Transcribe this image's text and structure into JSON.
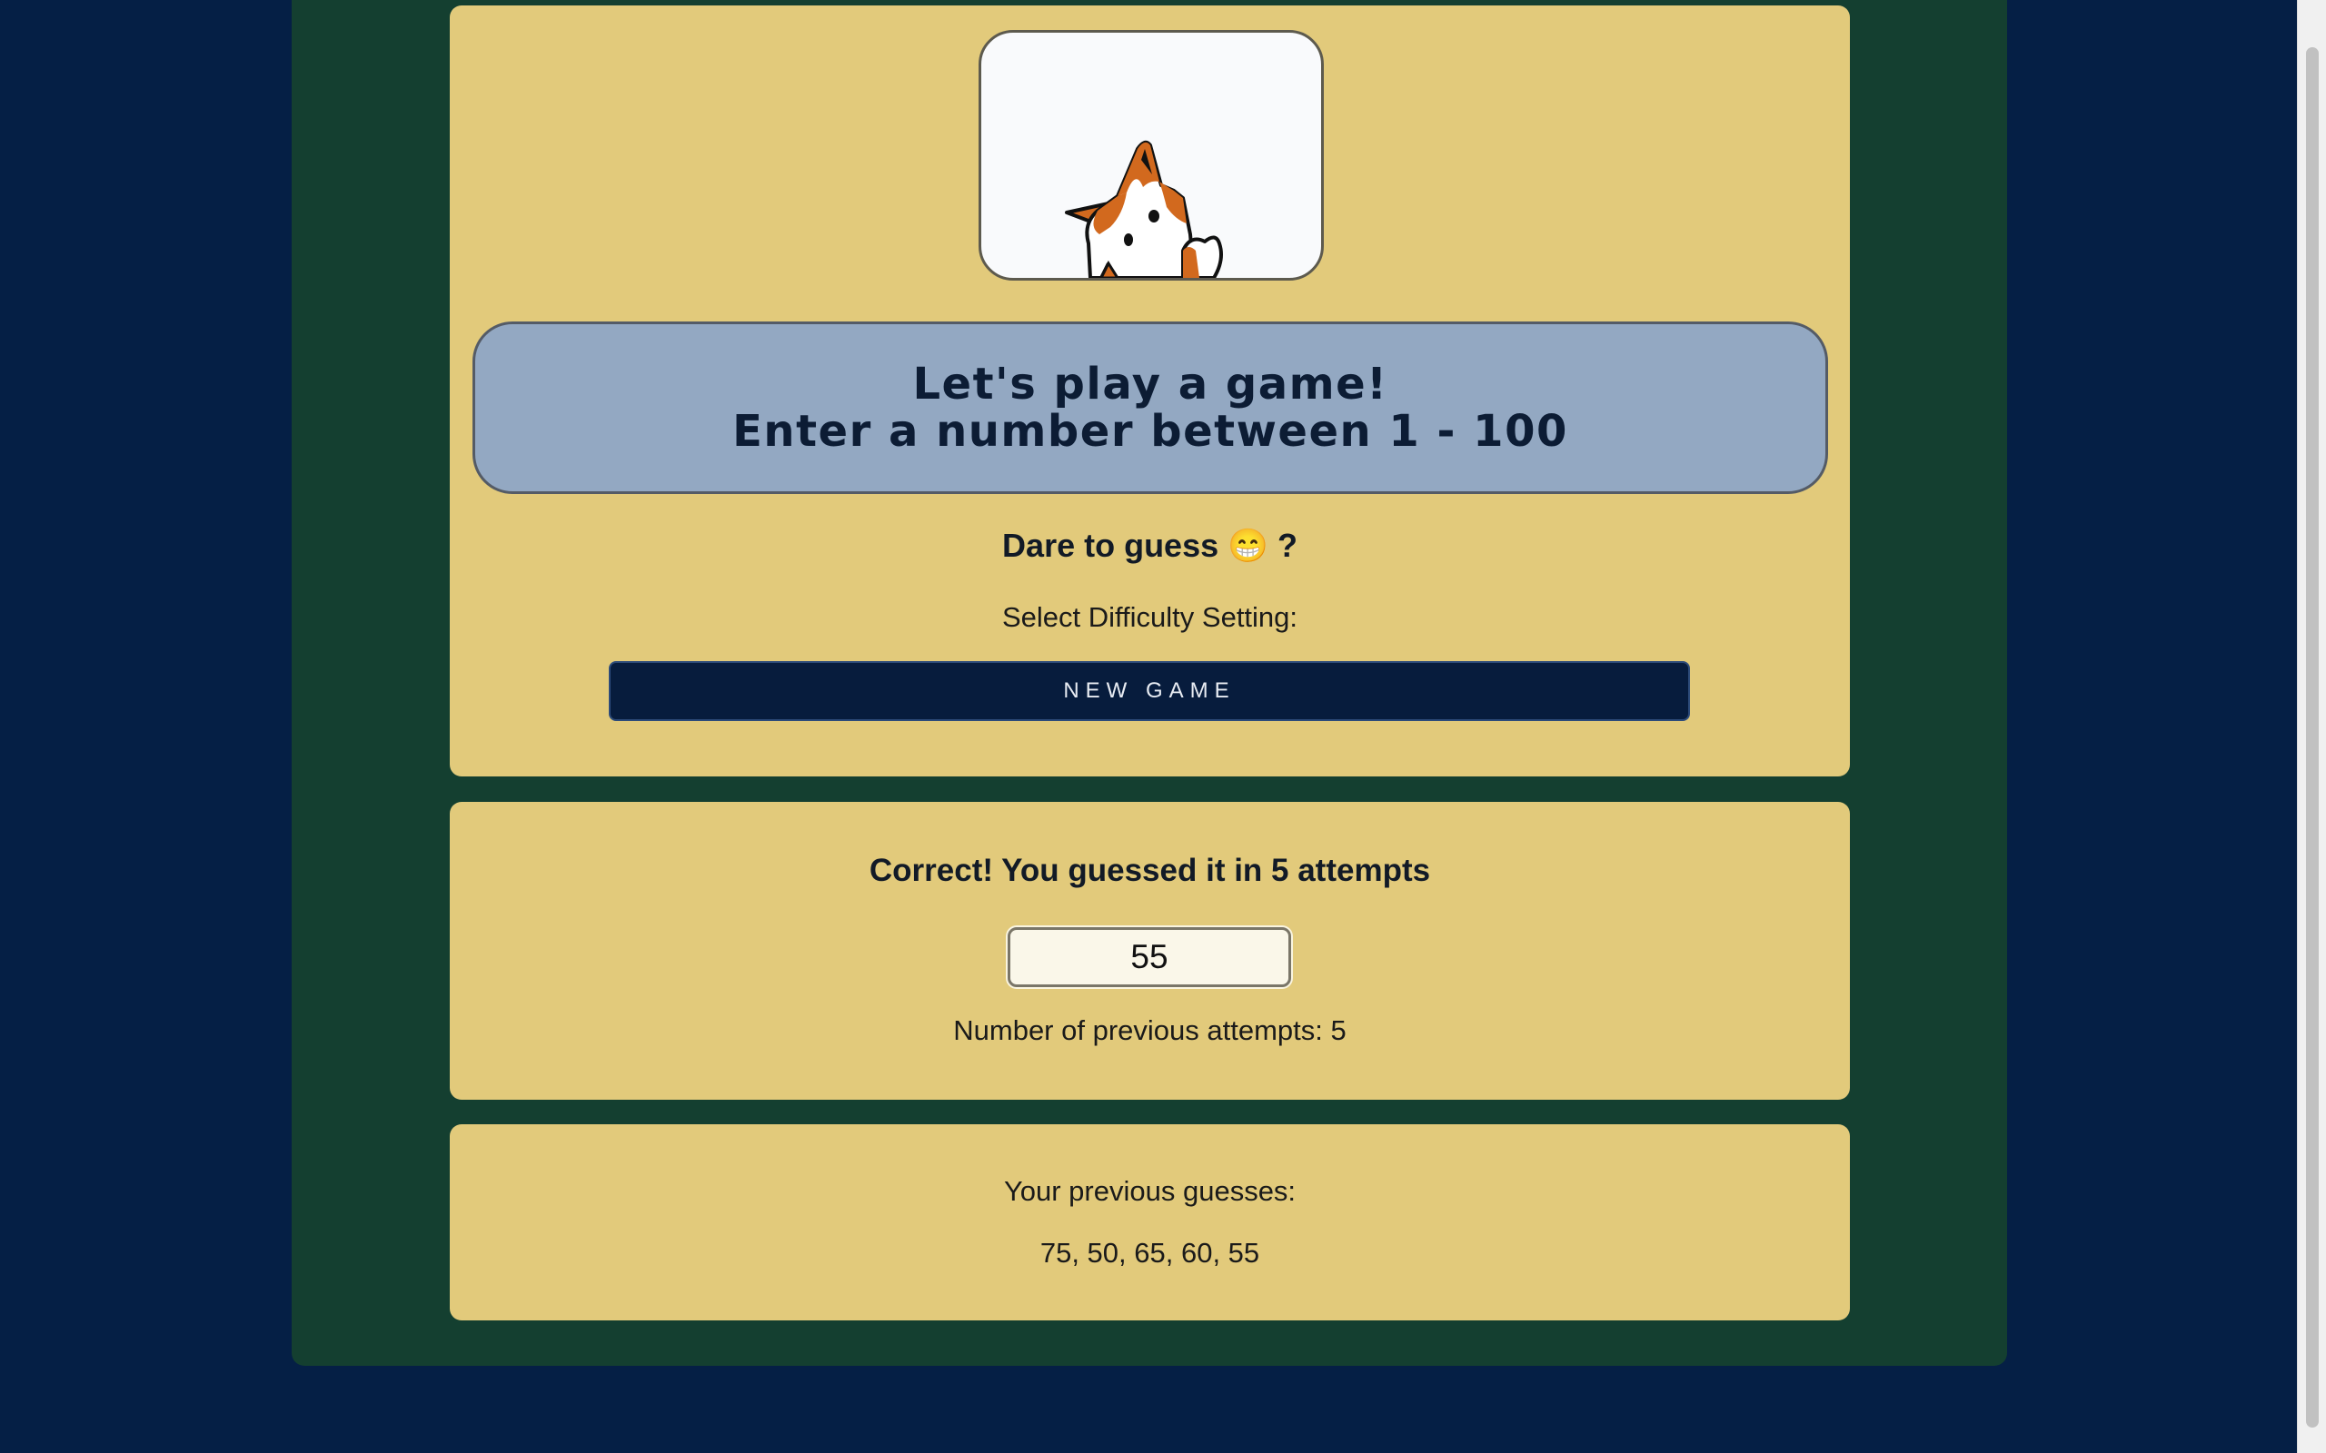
{
  "intro": {
    "line1": "Let's play a game!",
    "line2": "Enter a number between 1 - 100",
    "dare": "Dare to guess 😁 ?",
    "difficulty_label": "Select Difficulty Setting:",
    "new_game_label": "NEW GAME",
    "mascot_icon": "fox-icon"
  },
  "result": {
    "message": "Correct! You guessed it in 5 attempts",
    "guess_value": "55",
    "attempts_text": "Number of previous attempts: 5"
  },
  "history": {
    "label": "Your previous guesses:",
    "guesses": "75, 50, 65, 60, 55"
  },
  "colors": {
    "page_background": "#051f45",
    "outer_panel": "#143f30",
    "card": "#e2ca7b",
    "banner": "#93a8c2",
    "button": "#071c3d",
    "fox_orange": "#d2691e"
  }
}
